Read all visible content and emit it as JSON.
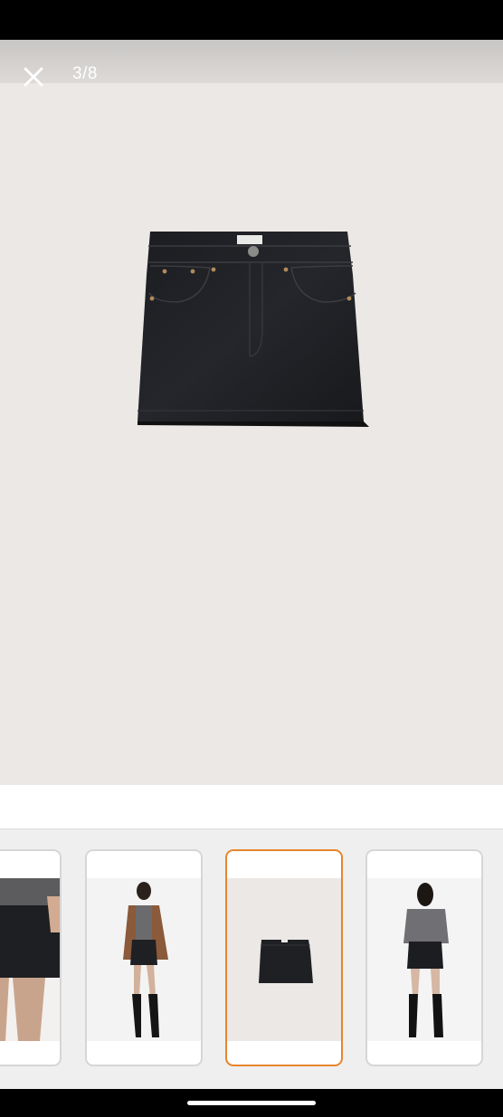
{
  "viewer": {
    "counter": "3/8",
    "close_icon": "close-icon",
    "main_image": "black-denim-mini-skirt"
  },
  "thumbnails": [
    {
      "name": "model-skirt-closeup",
      "selected": false
    },
    {
      "name": "model-front-brown-jacket",
      "selected": false
    },
    {
      "name": "black-denim-mini-skirt",
      "selected": true
    },
    {
      "name": "model-back-view",
      "selected": false
    }
  ],
  "colors": {
    "accent": "#e8852c",
    "viewer_background": "#ebe8e5"
  }
}
